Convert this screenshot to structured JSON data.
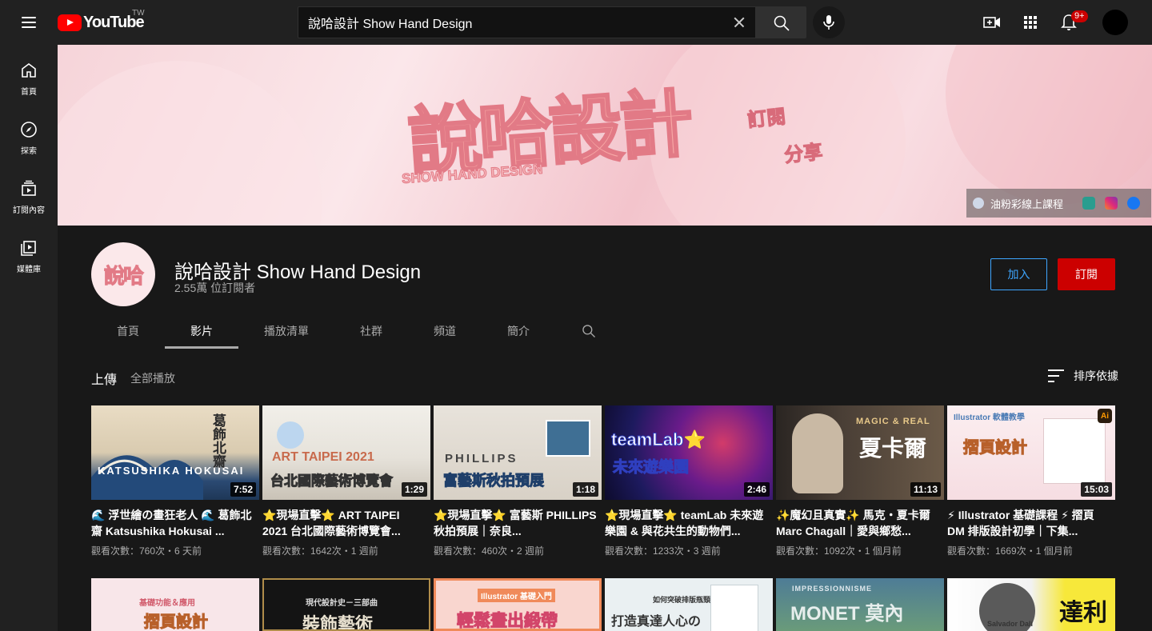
{
  "app": {
    "logo_text": "YouTube",
    "region": "TW"
  },
  "search": {
    "value": "說哈設計 Show Hand Design"
  },
  "header": {
    "notification_count": "9+"
  },
  "sidebar": {
    "items": [
      {
        "label": "首頁",
        "icon": "home-icon"
      },
      {
        "label": "探索",
        "icon": "compass-icon"
      },
      {
        "label": "訂閱內容",
        "icon": "subscriptions-icon"
      },
      {
        "label": "媒體庫",
        "icon": "library-icon"
      }
    ]
  },
  "banner": {
    "title": "說哈設計",
    "subtitle": "SHOW HAND DESIGN",
    "tag1": "訂閱",
    "tag2": "分享",
    "link_text": "油粉彩線上課程"
  },
  "channel": {
    "name": "說哈設計 Show Hand Design",
    "subscribers": "2.55萬 位訂閱者",
    "avatar_text": "說哈",
    "join_label": "加入",
    "subscribe_label": "訂閱"
  },
  "tabs": [
    {
      "label": "首頁",
      "active": false
    },
    {
      "label": "影片",
      "active": true
    },
    {
      "label": "播放清單",
      "active": false
    },
    {
      "label": "社群",
      "active": false
    },
    {
      "label": "頻道",
      "active": false
    },
    {
      "label": "簡介",
      "active": false
    }
  ],
  "uploads": {
    "title": "上傳",
    "play_all": "全部播放",
    "sort_label": "排序依據"
  },
  "videos": [
    {
      "title": "🌊 浮世繪の畫狂老人 🌊 葛飾北齋 Katsushika Hokusai ...",
      "meta": "觀看次數：760次・6 天前",
      "duration": "7:52",
      "thumb_text": "KATSUSHIKA HOKUSAI",
      "thumb_text2": "葛飾北齋"
    },
    {
      "title": "⭐現場直擊⭐ ART TAIPEI 2021 台北國際藝術博覽會...",
      "meta": "觀看次數：1642次・1 週前",
      "duration": "1:29",
      "thumb_text": "ART TAIPEI 2021",
      "thumb_text2": "台北國際藝術博覽會"
    },
    {
      "title": "⭐現場直擊⭐ 富藝斯 PHILLIPS 秋拍預展｜奈良...",
      "meta": "觀看次數：460次・2 週前",
      "duration": "1:18",
      "thumb_text": "PHILLIPS",
      "thumb_text2": "富藝斯秋拍預展"
    },
    {
      "title": "⭐現場直擊⭐ teamLab 未來遊樂園 & 與花共生的動物們...",
      "meta": "觀看次數：1233次・3 週前",
      "duration": "2:46",
      "thumb_text": "teamLab⭐",
      "thumb_text2": "未來遊樂園"
    },
    {
      "title": "✨魔幻且真實✨ 馬克・夏卡爾 Marc Chagall｜愛與鄉愁...",
      "meta": "觀看次數：1092次・1 個月前",
      "duration": "11:13",
      "thumb_text": "MAGIC & REAL",
      "thumb_text2": "夏卡爾"
    },
    {
      "title": "⚡ Illustrator 基礎課程 ⚡ 摺頁 DM 排版設計初學｜下集...",
      "meta": "觀看次數：1669次・1 個月前",
      "duration": "15:03",
      "thumb_text": "Illustrator 軟體教學",
      "thumb_text2": "摺頁設計"
    }
  ],
  "videos_row2": [
    {
      "thumb_text": "摺頁設計",
      "thumb_sub": "基礎功能＆應用"
    },
    {
      "thumb_text": "裝飾藝術",
      "thumb_sub": "現代設計史－三部曲"
    },
    {
      "thumb_text": "輕鬆畫出緞帶",
      "thumb_sub": "Illustrator 基礎入門"
    },
    {
      "thumb_text": "打造真達人心の",
      "thumb_sub": "如何突破排版瓶頸？"
    },
    {
      "thumb_text": "MONET 莫內",
      "thumb_sub": "IMPRESSIONNISME"
    },
    {
      "thumb_text": "達利",
      "thumb_sub": "Salvador Dalí"
    }
  ]
}
